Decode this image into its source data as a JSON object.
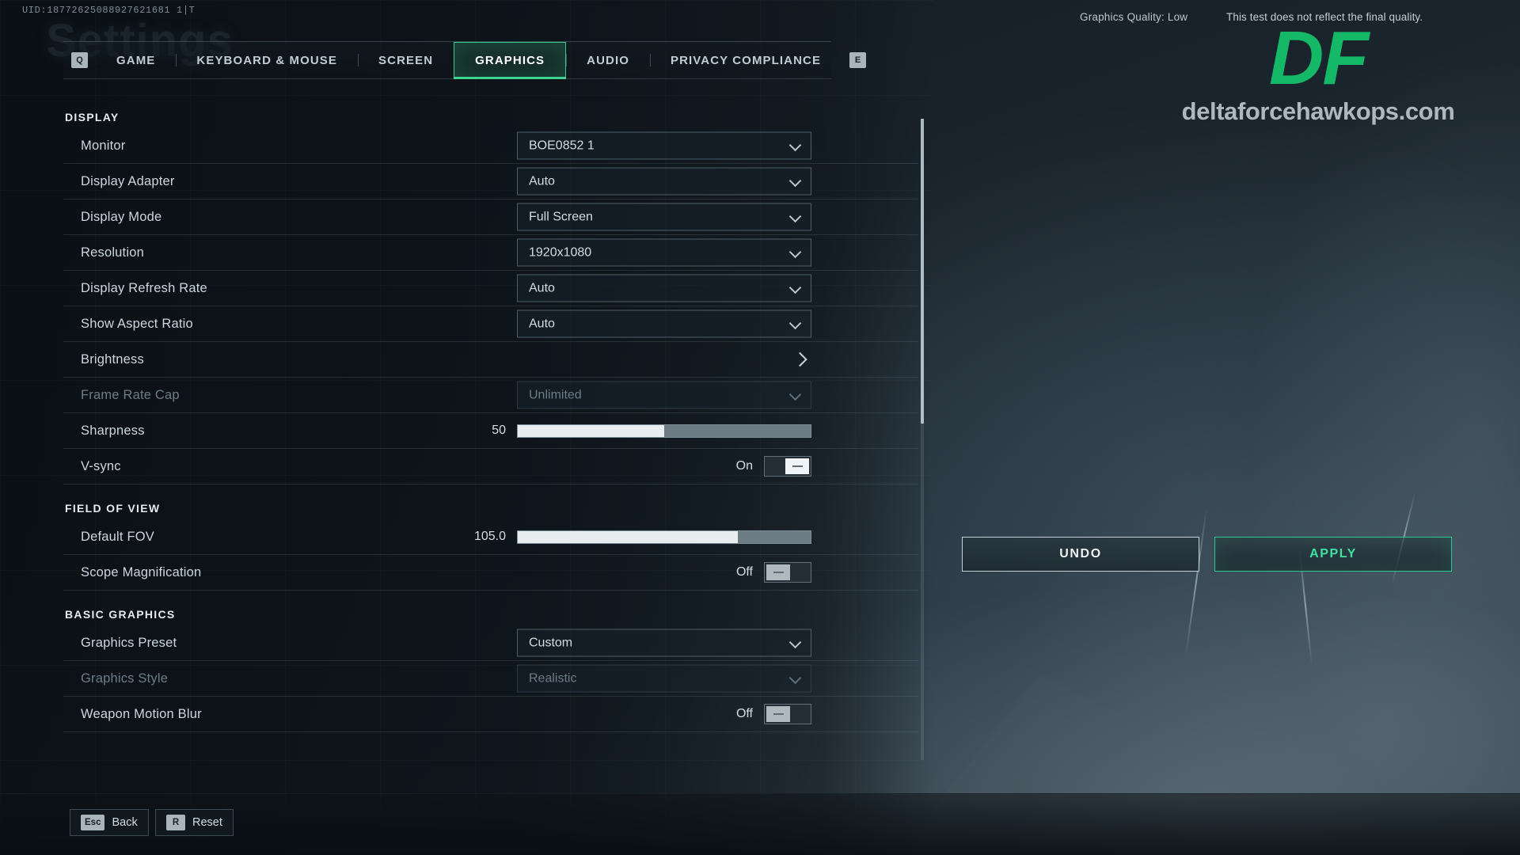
{
  "header": {
    "uid": "UID:18772625088927621681 1|T",
    "ghost_title": "Settings",
    "graphics_quality": "Graphics Quality: Low",
    "disclaimer": "This test does not reflect the final quality."
  },
  "tabs": {
    "left_key": "Q",
    "right_key": "E",
    "items": [
      {
        "label": "GAME",
        "active": false
      },
      {
        "label": "KEYBOARD & MOUSE",
        "active": false
      },
      {
        "label": "SCREEN",
        "active": false
      },
      {
        "label": "GRAPHICS",
        "active": true
      },
      {
        "label": "AUDIO",
        "active": false
      },
      {
        "label": "PRIVACY COMPLIANCE",
        "active": false
      }
    ]
  },
  "sections": [
    {
      "title": "DISPLAY",
      "rows": [
        {
          "label": "Monitor",
          "type": "dropdown",
          "value": "BOE0852 1",
          "disabled": false
        },
        {
          "label": "Display Adapter",
          "type": "dropdown",
          "value": "Auto",
          "disabled": false
        },
        {
          "label": "Display Mode",
          "type": "dropdown",
          "value": "Full Screen",
          "disabled": false
        },
        {
          "label": "Resolution",
          "type": "dropdown",
          "value": "1920x1080",
          "disabled": false
        },
        {
          "label": "Display Refresh Rate",
          "type": "dropdown",
          "value": "Auto",
          "disabled": false
        },
        {
          "label": "Show Aspect Ratio",
          "type": "dropdown",
          "value": "Auto",
          "disabled": false
        },
        {
          "label": "Brightness",
          "type": "submenu",
          "value": "",
          "disabled": false
        },
        {
          "label": "Frame Rate Cap",
          "type": "dropdown",
          "value": "Unlimited",
          "disabled": true
        },
        {
          "label": "Sharpness",
          "type": "slider",
          "value": "50",
          "percent": 50,
          "disabled": false
        },
        {
          "label": "V-sync",
          "type": "toggle",
          "value": "On",
          "state": "on",
          "disabled": false
        }
      ]
    },
    {
      "title": "FIELD OF VIEW",
      "rows": [
        {
          "label": "Default FOV",
          "type": "slider",
          "value": "105.0",
          "percent": 75,
          "disabled": false
        },
        {
          "label": "Scope Magnification",
          "type": "toggle",
          "value": "Off",
          "state": "off",
          "disabled": false
        }
      ]
    },
    {
      "title": "BASIC GRAPHICS",
      "rows": [
        {
          "label": "Graphics Preset",
          "type": "dropdown",
          "value": "Custom",
          "disabled": false
        },
        {
          "label": "Graphics Style",
          "type": "dropdown",
          "value": "Realistic",
          "disabled": true
        },
        {
          "label": "Weapon Motion Blur",
          "type": "toggle",
          "value": "Off",
          "state": "off",
          "disabled": false
        }
      ]
    }
  ],
  "actions": {
    "undo": "UNDO",
    "apply": "APPLY"
  },
  "footer": {
    "back_key": "Esc",
    "back_label": "Back",
    "reset_key": "R",
    "reset_label": "Reset"
  },
  "watermark": {
    "logo": "DF",
    "url": "deltaforcehawkops.com"
  },
  "colors": {
    "accent_green": "#3fd492",
    "apply_green": "#3fe2a0",
    "logo_green": "#14b866",
    "text_primary": "#d2dce3",
    "text_dim": "#6d7d88"
  }
}
